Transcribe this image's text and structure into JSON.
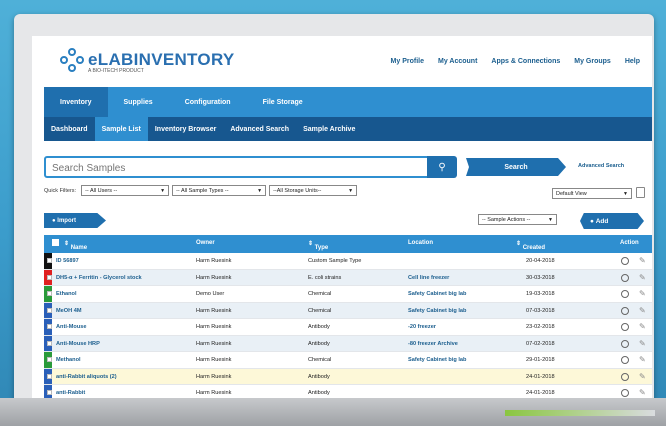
{
  "app": {
    "logo_text": "eLABINVENTORY",
    "logo_sub": "A BIO-ITECH PRODUCT"
  },
  "topnav": [
    "My Profile",
    "My Account",
    "Apps & Connections",
    "My Groups",
    "Help"
  ],
  "mainnav": [
    "Inventory",
    "Supplies",
    "Configuration",
    "File Storage"
  ],
  "subnav": [
    "Dashboard",
    "Sample List",
    "Inventory Browser",
    "Advanced Search",
    "Sample Archive"
  ],
  "search": {
    "placeholder": "Search Samples",
    "button_label": "Search",
    "advanced_label": "Advanced Search"
  },
  "filters": {
    "label": "Quick Filters:",
    "users": "-- All Users --",
    "sample_types": "-- All Sample Types --",
    "storage_units": "--All Storage Units--",
    "view": "Default View"
  },
  "actions": {
    "import_label": "Import",
    "sample_actions": "-- Sample Actions --",
    "add_label": "Add"
  },
  "table": {
    "headers": [
      "Name",
      "Owner",
      "Type",
      "Location",
      "Created",
      "Action"
    ],
    "rows": [
      {
        "color": "#111111",
        "name": "ID 56897",
        "owner": "Harm Ruesink",
        "type": "Custom Sample Type",
        "location": "",
        "created": "20-04-2018"
      },
      {
        "color": "#e02020",
        "name": "DH5-α + Ferritin - Glycerol stock",
        "owner": "Harm Ruesink",
        "type": "E. coli strains",
        "location": "Cell line freezer",
        "created": "30-03-2018"
      },
      {
        "color": "#2a9a3a",
        "name": "Ethanol",
        "owner": "Demo User",
        "type": "Chemical",
        "location": "Safety Cabinet big lab",
        "created": "19-03-2018"
      },
      {
        "color": "#2a5fb8",
        "name": "MeOH 4M",
        "owner": "Harm Ruesink",
        "type": "Chemical",
        "location": "Safety Cabinet big lab",
        "created": "07-03-2018"
      },
      {
        "color": "#2a5fb8",
        "name": "Anti-Mouse",
        "owner": "Harm Ruesink",
        "type": "Antibody",
        "location": "-20 freezer",
        "created": "23-02-2018"
      },
      {
        "color": "#2a5fb8",
        "name": "Anti-Mouse HRP",
        "owner": "Harm Ruesink",
        "type": "Antibody",
        "location": "-80 freezer Archive",
        "created": "07-02-2018"
      },
      {
        "color": "#2a9a3a",
        "name": "Methanol",
        "owner": "Harm Ruesink",
        "type": "Chemical",
        "location": "Safety Cabinet big lab",
        "created": "29-01-2018"
      },
      {
        "color": "#2a5fb8",
        "name": "anti-Rabbit aliquots (2)",
        "owner": "Harm Ruesink",
        "type": "Antibody",
        "location": "",
        "created": "24-01-2018"
      },
      {
        "color": "#2a5fb8",
        "name": "anti-Rabbit",
        "owner": "Harm Ruesink",
        "type": "Antibody",
        "location": "",
        "created": "24-01-2018"
      }
    ]
  }
}
